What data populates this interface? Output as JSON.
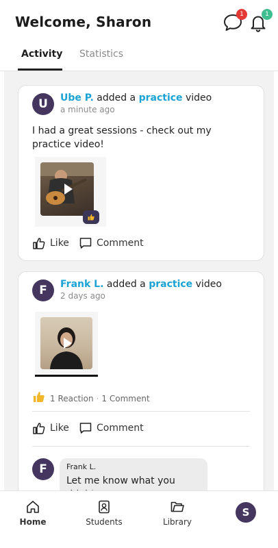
{
  "header": {
    "welcome": "Welcome, Sharon",
    "messages_badge": "1",
    "notifications_badge": "1"
  },
  "tabs": [
    {
      "label": "Activity",
      "active": true
    },
    {
      "label": "Statistics",
      "active": false
    }
  ],
  "posts": [
    {
      "avatar_letter": "U",
      "author": "Ube P.",
      "verb": "added a",
      "kind": "practice",
      "object": "video",
      "time": "a minute ago",
      "text": "I had a great sessions - check out my practice video!",
      "thumb_reaction_icon": "thumbs-up-icon",
      "like_label": "Like",
      "comment_label": "Comment"
    },
    {
      "avatar_letter": "F",
      "author": "Frank L.",
      "verb": "added a",
      "kind": "practice",
      "object": "video",
      "time": "2 days ago",
      "reaction_icon": "thumbs-up-emoji",
      "reaction_count": "1 Reaction",
      "comment_count": "1 Comment",
      "like_label": "Like",
      "comment_label": "Comment",
      "comments": [
        {
          "avatar_letter": "F",
          "author": "Frank L.",
          "text": "Let me know what you think!"
        }
      ]
    }
  ],
  "bottom_nav": [
    {
      "label": "Home",
      "icon": "home-icon",
      "active": true
    },
    {
      "label": "Students",
      "icon": "students-icon",
      "active": false
    },
    {
      "label": "Library",
      "icon": "folder-icon",
      "active": false
    }
  ],
  "profile_letter": "S",
  "colors": {
    "accent": "#1aa3d4",
    "avatar": "#44365e",
    "badge_red": "#e53935",
    "badge_green": "#3fbf8f"
  }
}
